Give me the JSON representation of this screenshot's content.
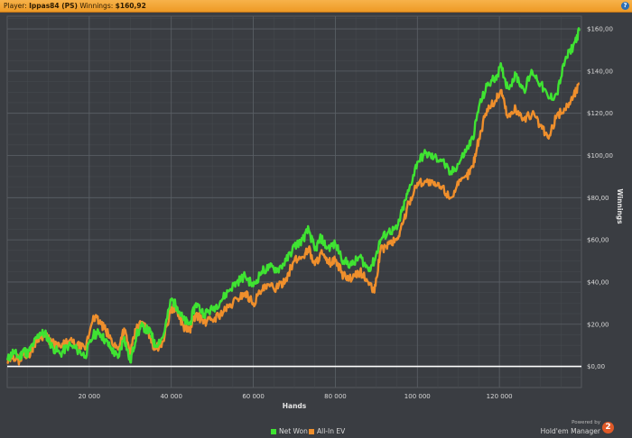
{
  "header": {
    "player_label": "Player:",
    "player_value": "Ippas84 (PS)",
    "winnings_label": "Winnings:",
    "winnings_value": "$160,92",
    "help_glyph": "?"
  },
  "legend": {
    "net_won": "Net Won",
    "allin_ev": "All-In EV"
  },
  "brand": {
    "powered_by": "Powered by",
    "product": "Hold'em Manager",
    "badge": "2"
  },
  "colors": {
    "net_won": "#3fe332",
    "allin_ev": "#ef8f2c",
    "zero_line": "#ffffff",
    "grid": "#4f5358",
    "background": "#3a3d42"
  },
  "chart_data": {
    "type": "line",
    "xlabel": "Hands",
    "ylabel": "Winnings",
    "xlim": [
      0,
      140000
    ],
    "ylim": [
      -10,
      166
    ],
    "x_ticks": [
      20000,
      40000,
      60000,
      80000,
      100000,
      120000
    ],
    "x_tick_labels": [
      "20 000",
      "40 000",
      "60 000",
      "80 000",
      "100 000",
      "120 000"
    ],
    "y_ticks": [
      0,
      20,
      40,
      60,
      80,
      100,
      120,
      140,
      160
    ],
    "y_tick_labels": [
      "$0,00",
      "$20,00",
      "$40,00",
      "$60,00",
      "$80,00",
      "$100,00",
      "$120,00",
      "$140,00",
      "$160,00"
    ],
    "grid": true,
    "legend_position": "bottom",
    "series": [
      {
        "name": "Net Won",
        "color": "#3fe332",
        "x": [
          0,
          1500,
          3000,
          4000,
          5000,
          6500,
          8000,
          9500,
          11000,
          13000,
          15000,
          17000,
          19000,
          21000,
          22500,
          24000,
          25500,
          27000,
          28500,
          30000,
          31500,
          33000,
          35000,
          36000,
          38000,
          40000,
          41500,
          43000,
          44500,
          46000,
          48000,
          50000,
          52000,
          54000,
          56000,
          58000,
          60000,
          62000,
          64000,
          66000,
          68000,
          70000,
          72000,
          73500,
          75000,
          76500,
          78000,
          80000,
          82000,
          84000,
          86000,
          88000,
          89500,
          91000,
          93000,
          95000,
          96500,
          98000,
          100000,
          102000,
          104000,
          106000,
          108000,
          110000,
          112000,
          113500,
          115000,
          117000,
          119000,
          120500,
          122000,
          124000,
          126000,
          128000,
          130000,
          132000,
          134000,
          136000,
          138000,
          139500
        ],
        "y": [
          3,
          7,
          4,
          8,
          6,
          11,
          16,
          15,
          9,
          6,
          10,
          8,
          5,
          15,
          16,
          12,
          8,
          4,
          14,
          2,
          15,
          19,
          16,
          10,
          14,
          32,
          28,
          22,
          20,
          30,
          25,
          27,
          31,
          36,
          40,
          43,
          38,
          45,
          47,
          46,
          50,
          57,
          60,
          65,
          55,
          61,
          56,
          58,
          50,
          48,
          52,
          46,
          50,
          60,
          64,
          65,
          75,
          84,
          97,
          101,
          99,
          98,
          91,
          96,
          103,
          108,
          123,
          133,
          137,
          142,
          132,
          138,
          131,
          140,
          134,
          127,
          129,
          145,
          152,
          159
        ]
      },
      {
        "name": "All-In EV",
        "color": "#ef8f2c",
        "x": [
          0,
          1500,
          3000,
          4000,
          5000,
          6500,
          8000,
          9500,
          11000,
          13000,
          15000,
          17000,
          19000,
          21000,
          22500,
          24000,
          25500,
          27000,
          28500,
          30000,
          31500,
          33000,
          35000,
          36000,
          38000,
          40000,
          41500,
          43000,
          44500,
          46000,
          48000,
          50000,
          52000,
          54000,
          56000,
          58000,
          60000,
          62000,
          64000,
          66000,
          68000,
          70000,
          72000,
          73500,
          75000,
          76500,
          78000,
          80000,
          82000,
          84000,
          86000,
          88000,
          89500,
          91000,
          93000,
          95000,
          96500,
          98000,
          100000,
          102000,
          104000,
          106000,
          108000,
          110000,
          112000,
          113500,
          115000,
          117000,
          119000,
          120500,
          122000,
          124000,
          126000,
          128000,
          130000,
          132000,
          134000,
          136000,
          138000,
          139500
        ],
        "y": [
          2,
          5,
          3,
          7,
          5,
          10,
          15,
          14,
          11,
          9,
          12,
          10,
          8,
          24,
          21,
          17,
          12,
          8,
          18,
          6,
          18,
          21,
          14,
          8,
          12,
          28,
          26,
          19,
          17,
          25,
          21,
          22,
          25,
          28,
          32,
          35,
          30,
          36,
          38,
          37,
          42,
          50,
          52,
          56,
          48,
          54,
          49,
          50,
          43,
          41,
          45,
          40,
          35,
          55,
          58,
          60,
          68,
          78,
          87,
          88,
          86,
          85,
          80,
          86,
          90,
          95,
          108,
          122,
          126,
          131,
          118,
          122,
          117,
          120,
          114,
          108,
          119,
          122,
          128,
          134
        ]
      }
    ]
  }
}
